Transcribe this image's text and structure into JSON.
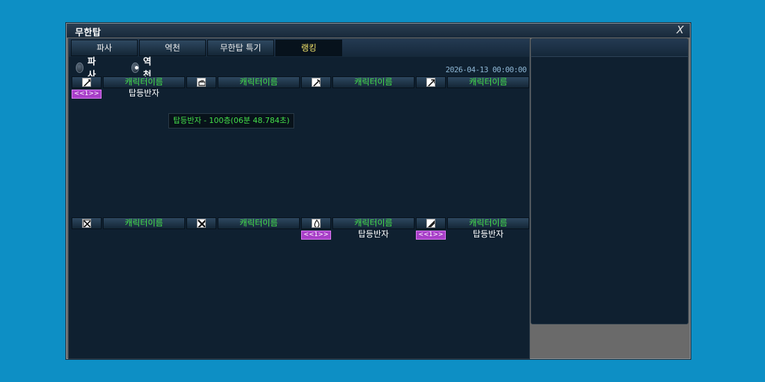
{
  "window": {
    "title": "무한탑",
    "close_label": "X"
  },
  "tabs": [
    {
      "label": "파사"
    },
    {
      "label": "역천"
    },
    {
      "label": "무한탑 특기"
    },
    {
      "label": "랭킹",
      "active": true
    }
  ],
  "filter": {
    "options": [
      {
        "label": "파사",
        "checked": false
      },
      {
        "label": "역천",
        "checked": true
      }
    ]
  },
  "date": "2026-04-13 00:00:00",
  "rows": [
    {
      "slots": [
        {
          "icon": "sword-icon",
          "name": "캐릭터이름",
          "rank": "<<1>>",
          "title": "탑등반자"
        },
        {
          "icon": "fist-icon",
          "name": "캐릭터이름"
        },
        {
          "icon": "axe-icon",
          "name": "캐릭터이름"
        },
        {
          "icon": "arrow-icon",
          "name": "캐릭터이름"
        }
      ]
    },
    {
      "slots": [
        {
          "icon": "cross-swords-icon",
          "name": "캐릭터이름"
        },
        {
          "icon": "cross-blades-icon",
          "name": "캐릭터이름"
        },
        {
          "icon": "fire-icon",
          "name": "캐릭터이름",
          "rank": "<<1>>",
          "title": "탑등반자"
        },
        {
          "icon": "blade-icon",
          "name": "캐릭터이름",
          "rank": "<<1>>",
          "title": "탑등반자"
        }
      ]
    }
  ],
  "tooltip": {
    "text": "탑등반자 - 100층(06분 48.784초)"
  },
  "colors": {
    "background": "#0d8fc5",
    "panel": "#0f2030",
    "name_green": "#44e04a",
    "active_tab_text": "#f2e36a",
    "rank_badge": "#a83fc8"
  }
}
